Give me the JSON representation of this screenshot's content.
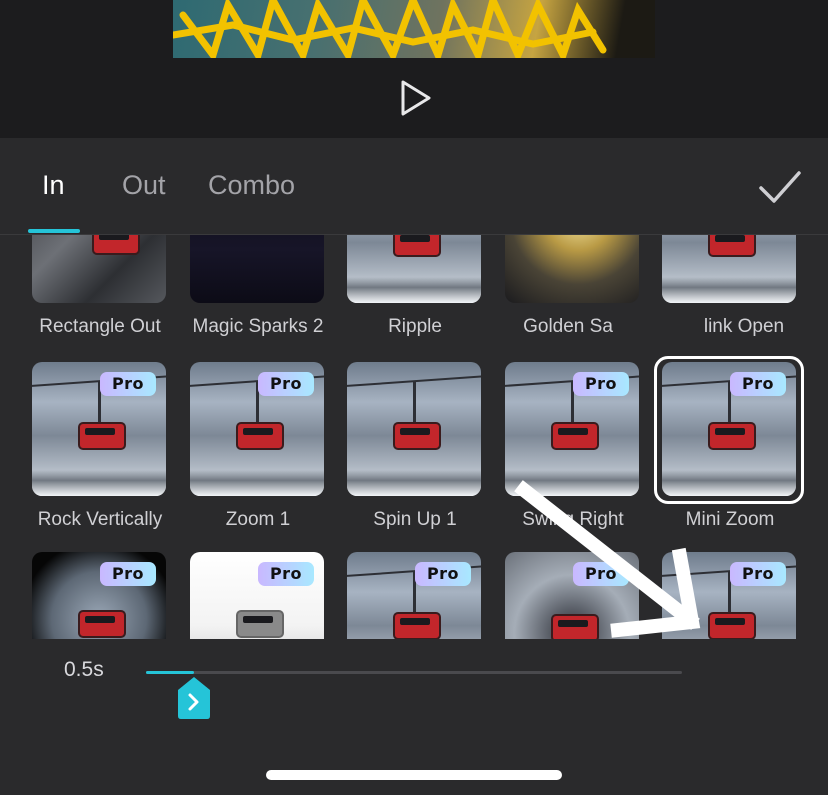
{
  "player": {
    "play_icon": "play-icon"
  },
  "tabs": [
    {
      "label": "In",
      "active": true
    },
    {
      "label": "Out",
      "active": false
    },
    {
      "label": "Combo",
      "active": false
    }
  ],
  "confirm_icon": "checkmark-icon",
  "accent_color": "#25c4d8",
  "effects_row1": [
    {
      "label": "Rectangle Out"
    },
    {
      "label": "Magic Sparks 2"
    },
    {
      "label": "Ripple"
    },
    {
      "label": "Golden Sa"
    },
    {
      "label": "link Open"
    }
  ],
  "effects_row2": [
    {
      "label": "Rock Vertically",
      "pro": "Pro"
    },
    {
      "label": "Zoom 1",
      "pro": "Pro"
    },
    {
      "label": "Spin Up 1"
    },
    {
      "label": "Swing Right",
      "pro": "Pro"
    },
    {
      "label": "Mini Zoom",
      "pro": "Pro",
      "selected": true
    }
  ],
  "effects_row3": [
    {
      "pro": "Pro"
    },
    {
      "pro": "Pro"
    },
    {
      "pro": "Pro"
    },
    {
      "pro": "Pro"
    },
    {
      "pro": "Pro"
    }
  ],
  "duration": {
    "value_label": "0.5s",
    "slider_fraction": 0.09
  },
  "slider_thumb_icon": "chevron-right-icon"
}
